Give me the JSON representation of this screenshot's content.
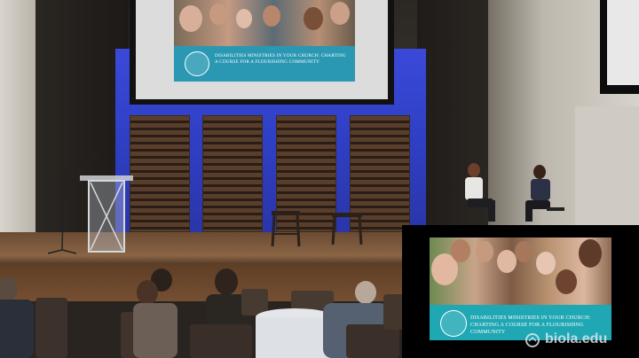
{
  "projector_slide": {
    "banner_text": "Disabilities Ministries in your Church: Charting a Course for a Flourishing Community"
  },
  "overlay_slide": {
    "banner_text": "Disabilities Ministries in your Church: Charting a Course for a Flourishing Community"
  },
  "watermark": {
    "text": "biola.edu",
    "icon": "biola-seal-icon"
  },
  "colors": {
    "stage_blue": "#2f3fc4",
    "banner_teal": "#20a7b4"
  }
}
